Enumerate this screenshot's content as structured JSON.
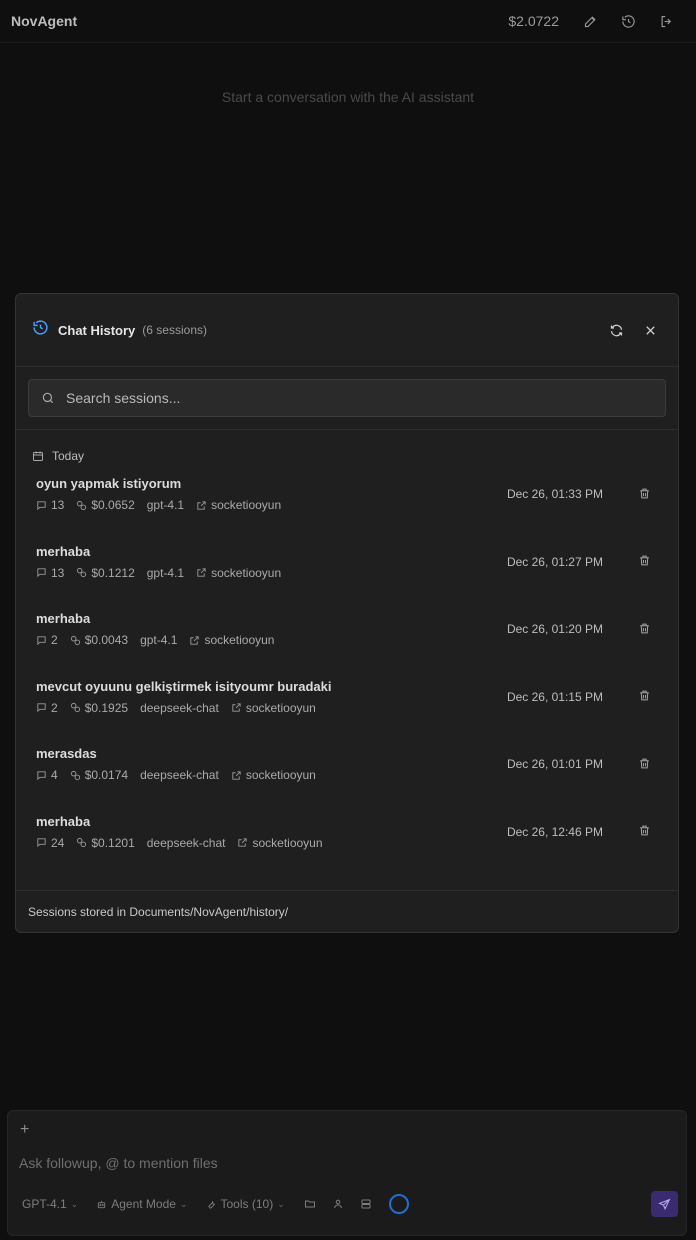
{
  "app": {
    "title": "NovAgent",
    "cost": "$2.0722"
  },
  "icons": {
    "edit": "edit-icon",
    "history": "history-icon",
    "logout": "logout-icon",
    "refresh": "refresh-icon",
    "close": "close-icon",
    "search": "search-icon",
    "calendar": "calendar-icon",
    "message": "message-icon",
    "coin": "coin-icon",
    "external": "external-link-icon",
    "trash": "trash-icon"
  },
  "main": {
    "empty_message": "Start a conversation with the AI assistant"
  },
  "history": {
    "title": "Chat History",
    "count": "(6 sessions)",
    "search_placeholder": "Search sessions...",
    "group_label": "Today",
    "sessions": [
      {
        "title": "oyun yapmak istiyorum",
        "messages": "13",
        "cost": "$0.0652",
        "model": "gpt-4.1",
        "project": "socketiooyun",
        "date": "Dec 26, 01:33 PM"
      },
      {
        "title": "merhaba",
        "messages": "13",
        "cost": "$0.1212",
        "model": "gpt-4.1",
        "project": "socketiooyun",
        "date": "Dec 26, 01:27 PM"
      },
      {
        "title": "merhaba",
        "messages": "2",
        "cost": "$0.0043",
        "model": "gpt-4.1",
        "project": "socketiooyun",
        "date": "Dec 26, 01:20 PM"
      },
      {
        "title": "mevcut oyuunu gelkiştirmek isityoumr buradaki",
        "messages": "2",
        "cost": "$0.1925",
        "model": "deepseek-chat",
        "project": "socketiooyun",
        "date": "Dec 26, 01:15 PM"
      },
      {
        "title": "merasdas",
        "messages": "4",
        "cost": "$0.0174",
        "model": "deepseek-chat",
        "project": "socketiooyun",
        "date": "Dec 26, 01:01 PM"
      },
      {
        "title": "merhaba",
        "messages": "24",
        "cost": "$0.1201",
        "model": "deepseek-chat",
        "project": "socketiooyun",
        "date": "Dec 26, 12:46 PM"
      }
    ],
    "footer": "Sessions stored in Documents/NovAgent/history/"
  },
  "composer": {
    "add_label": "+",
    "placeholder": "Ask followup, @ to mention files",
    "model": "GPT-4.1",
    "mode": "Agent Mode",
    "tools": "Tools (10)"
  },
  "colors": {
    "accent": "#4ea1ff",
    "send_bg": "#3a2a6e",
    "ring": "#1f6fd1"
  }
}
